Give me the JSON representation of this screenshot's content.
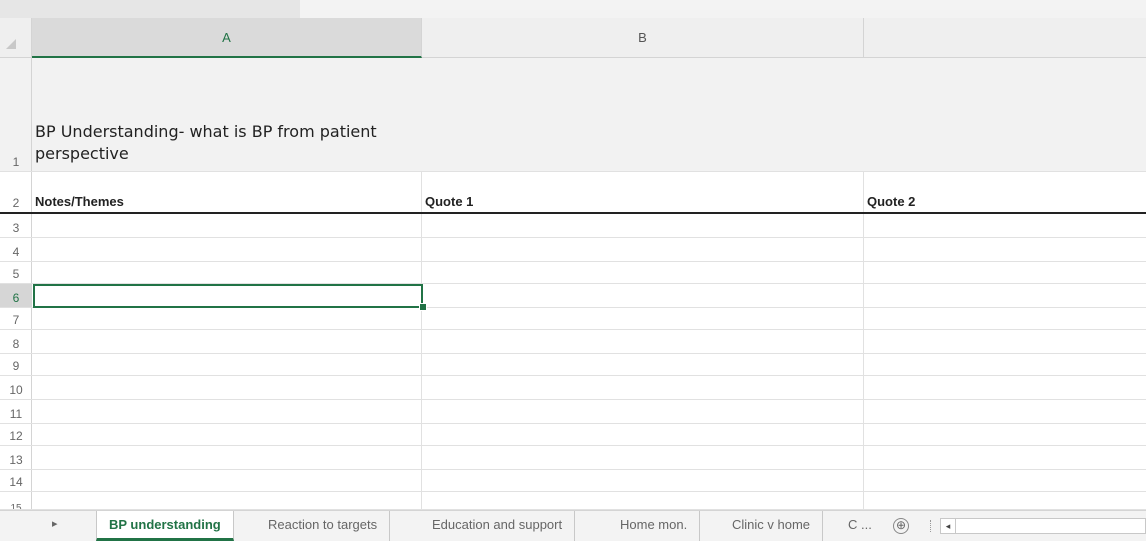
{
  "columns": [
    "A",
    "B"
  ],
  "selected_column": "A",
  "rows": [
    {
      "num": "1",
      "a": "BP Understanding- what is BP from patient perspective",
      "b": "",
      "c": ""
    },
    {
      "num": "2",
      "a": "Notes/Themes",
      "b": "Quote 1",
      "c": "Quote 2"
    },
    {
      "num": "3"
    },
    {
      "num": "4"
    },
    {
      "num": "5"
    },
    {
      "num": "6"
    },
    {
      "num": "7"
    },
    {
      "num": "8"
    },
    {
      "num": "9"
    },
    {
      "num": "10"
    },
    {
      "num": "11"
    },
    {
      "num": "12"
    },
    {
      "num": "13"
    },
    {
      "num": "14"
    },
    {
      "num": "15"
    }
  ],
  "selected_row": "6",
  "sheet_tabs": [
    {
      "label": "BP understanding",
      "active": true
    },
    {
      "label": "Reaction to targets",
      "active": false
    },
    {
      "label": "Education and support",
      "active": false
    },
    {
      "label": "Home mon.",
      "active": false
    },
    {
      "label": "Clinic v home",
      "active": false
    },
    {
      "label": "C ...",
      "active": false
    }
  ],
  "nav": {
    "next_sheet_icon": "▸"
  },
  "add_sheet_icon": "⊕",
  "scroll_left_icon": "◂",
  "accent_color": "#217346"
}
